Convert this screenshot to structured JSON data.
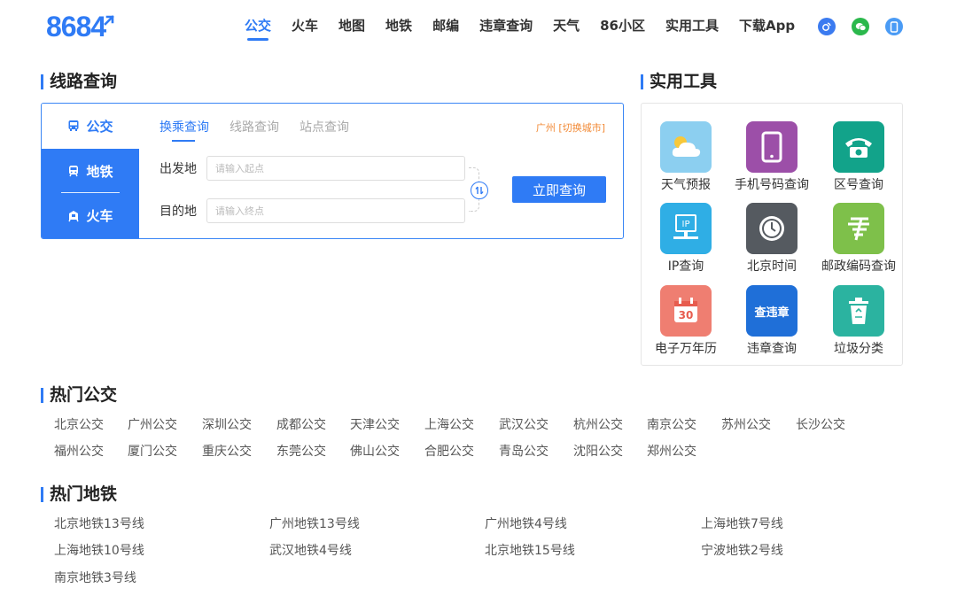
{
  "header": {
    "logo": "8684",
    "nav": [
      "公交",
      "火车",
      "地图",
      "地铁",
      "邮编",
      "违章查询",
      "天气",
      "86小区",
      "实用工具",
      "下载App"
    ],
    "nav_active": 0,
    "social_icons": [
      {
        "name": "weibo-icon",
        "color": "#3b7bf0"
      },
      {
        "name": "wechat-icon",
        "color": "#2bb84c"
      },
      {
        "name": "mobile-icon",
        "color": "#4a9bf5"
      }
    ]
  },
  "route": {
    "title": "线路查询",
    "side_tabs": [
      "公交",
      "地铁",
      "火车"
    ],
    "tabs": [
      "换乘查询",
      "线路查询",
      "站点查询"
    ],
    "city": "广州 [切换城市]",
    "from_label": "出发地",
    "from_placeholder": "请输入起点",
    "to_label": "目的地",
    "to_placeholder": "请输入终点",
    "submit": "立即查询"
  },
  "tools": {
    "title": "实用工具",
    "items": [
      {
        "label": "天气预报",
        "icon": "weather-icon",
        "color": "#8ccff0"
      },
      {
        "label": "手机号码查询",
        "icon": "phone-icon",
        "color": "#9c4fa8"
      },
      {
        "label": "区号查询",
        "icon": "telephone-icon",
        "color": "#12a38a"
      },
      {
        "label": "IP查询",
        "icon": "ip-icon",
        "color": "#2faee5"
      },
      {
        "label": "北京时间",
        "icon": "clock-icon",
        "color": "#555a60"
      },
      {
        "label": "邮政编码查询",
        "icon": "postal-icon",
        "color": "#7ec04a"
      },
      {
        "label": "电子万年历",
        "icon": "calendar-icon",
        "color": "#ef7e71"
      },
      {
        "label": "违章查询",
        "icon": "violation-icon",
        "color": "#1f6fd8",
        "text": "查违章"
      },
      {
        "label": "垃圾分类",
        "icon": "trash-icon",
        "color": "#2bb3a0"
      }
    ]
  },
  "hot_bus": {
    "title": "热门公交",
    "items": [
      "北京公交",
      "广州公交",
      "深圳公交",
      "成都公交",
      "天津公交",
      "上海公交",
      "武汉公交",
      "杭州公交",
      "南京公交",
      "苏州公交",
      "长沙公交",
      "福州公交",
      "厦门公交",
      "重庆公交",
      "东莞公交",
      "佛山公交",
      "合肥公交",
      "青岛公交",
      "沈阳公交",
      "郑州公交"
    ]
  },
  "hot_subway": {
    "title": "热门地铁",
    "items": [
      "北京地铁13号线",
      "广州地铁13号线",
      "广州地铁4号线",
      "上海地铁7号线",
      "上海地铁10号线",
      "武汉地铁4号线",
      "北京地铁15号线",
      "宁波地铁2号线",
      "南京地铁3号线"
    ]
  }
}
